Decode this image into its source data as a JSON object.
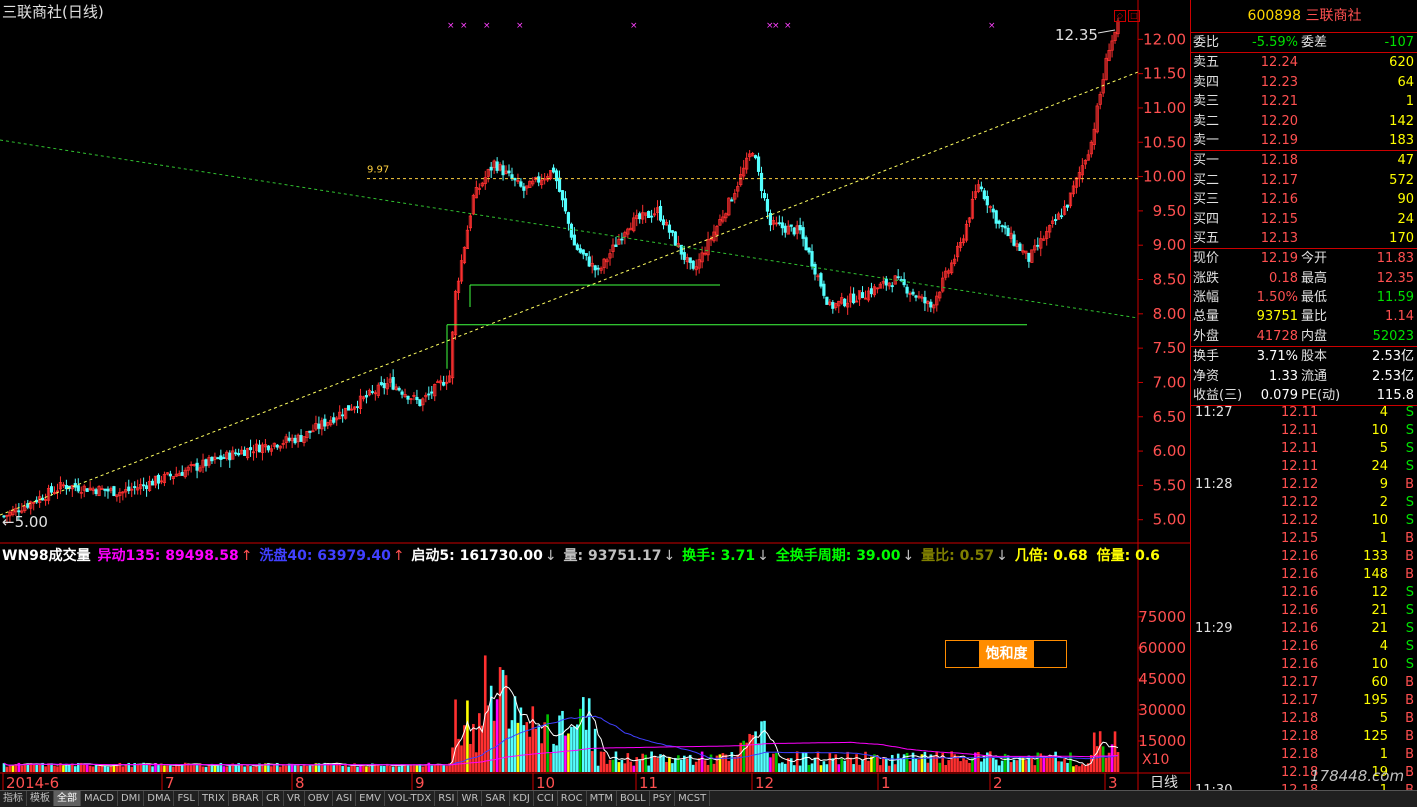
{
  "window": {
    "title": "三联商社(日线)"
  },
  "chart_data": {
    "type": "candlestick",
    "price_ticks": [
      "12.00",
      "11.50",
      "11.00",
      "10.50",
      "10.00",
      "9.50",
      "9.00",
      "8.50",
      "8.00",
      "7.50",
      "7.00",
      "6.50",
      "6.00",
      "5.50",
      "5.00"
    ],
    "volume_ticks": [
      "75000",
      "60000",
      "45000",
      "30000",
      "15000"
    ],
    "x_labels": [
      "2014-6",
      "7",
      "8",
      "9",
      "10",
      "11",
      "12",
      "1",
      "2",
      "3"
    ],
    "ylim": [
      4.85,
      12.5
    ],
    "annotations": {
      "high_label": "12.35",
      "low_label": "5.00",
      "level_label": "9.97"
    },
    "vol_ylim": [
      0,
      88000
    ]
  },
  "vol_header": {
    "name": "WN98成交量",
    "items": [
      {
        "label": "异动135: 89498.58",
        "arrow": "↑",
        "color": "#ff00ff"
      },
      {
        "label": "洗盘40: 63979.40",
        "arrow": "↑",
        "color": "#4040ff"
      },
      {
        "label": "启动5: 161730.00",
        "arrow": "↓",
        "color": "#ffffff"
      },
      {
        "label": "量: 93751.17",
        "arrow": "↓",
        "color": "#c0c0c0"
      },
      {
        "label": "换手: 3.71",
        "arrow": "↓",
        "color": "#00ff00"
      },
      {
        "label": "全换手周期: 39.00",
        "arrow": "↓",
        "color": "#00ff00"
      },
      {
        "label": "量比: 0.57",
        "arrow": "↓",
        "color": "#808000"
      },
      {
        "label": "几倍: 0.68",
        "arrow": "",
        "color": "#ffff00"
      },
      {
        "label": "倍量: 0.6",
        "arrow": "",
        "color": "#ffff00"
      }
    ]
  },
  "saturation_label": "饱和度",
  "x10_label": "X10",
  "period_label": "日线",
  "stock": {
    "code": "600898",
    "name": "三联商社"
  },
  "order_book": {
    "ratio": {
      "label": "委比",
      "value": "-5.59%",
      "label2": "委差",
      "value2": "-107"
    },
    "sell": [
      {
        "label": "卖五",
        "price": "12.24",
        "vol": "620"
      },
      {
        "label": "卖四",
        "price": "12.23",
        "vol": "64"
      },
      {
        "label": "卖三",
        "price": "12.21",
        "vol": "1"
      },
      {
        "label": "卖二",
        "price": "12.20",
        "vol": "142"
      },
      {
        "label": "卖一",
        "price": "12.19",
        "vol": "183"
      }
    ],
    "buy": [
      {
        "label": "买一",
        "price": "12.18",
        "vol": "47"
      },
      {
        "label": "买二",
        "price": "12.17",
        "vol": "572"
      },
      {
        "label": "买三",
        "price": "12.16",
        "vol": "90"
      },
      {
        "label": "买四",
        "price": "12.15",
        "vol": "24"
      },
      {
        "label": "买五",
        "price": "12.13",
        "vol": "170"
      }
    ]
  },
  "quote": [
    {
      "l1": "现价",
      "v1": "12.19",
      "c1": "red",
      "l2": "今开",
      "v2": "11.83",
      "c2": "red"
    },
    {
      "l1": "涨跌",
      "v1": "0.18",
      "c1": "red",
      "l2": "最高",
      "v2": "12.35",
      "c2": "red"
    },
    {
      "l1": "涨幅",
      "v1": "1.50%",
      "c1": "red",
      "l2": "最低",
      "v2": "11.59",
      "c2": "green"
    },
    {
      "l1": "总量",
      "v1": "93751",
      "c1": "yellow",
      "l2": "量比",
      "v2": "1.14",
      "c2": "red"
    },
    {
      "l1": "外盘",
      "v1": "41728",
      "c1": "red",
      "l2": "内盘",
      "v2": "52023",
      "c2": "green"
    }
  ],
  "fundamentals": [
    {
      "l1": "换手",
      "v1": "3.71%",
      "l2": "股本",
      "v2": "2.53亿"
    },
    {
      "l1": "净资",
      "v1": "1.33",
      "l2": "流通",
      "v2": "2.53亿"
    },
    {
      "l1": "收益(三)",
      "v1": "0.079",
      "l2": "PE(动)",
      "v2": "115.8"
    }
  ],
  "ticks": [
    {
      "time": "11:27",
      "price": "12.11",
      "vol": "4",
      "side": "S"
    },
    {
      "time": "",
      "price": "12.11",
      "vol": "10",
      "side": "S"
    },
    {
      "time": "",
      "price": "12.11",
      "vol": "5",
      "side": "S"
    },
    {
      "time": "",
      "price": "12.11",
      "vol": "24",
      "side": "S"
    },
    {
      "time": "11:28",
      "price": "12.12",
      "vol": "9",
      "side": "B"
    },
    {
      "time": "",
      "price": "12.12",
      "vol": "2",
      "side": "S"
    },
    {
      "time": "",
      "price": "12.12",
      "vol": "10",
      "side": "S"
    },
    {
      "time": "",
      "price": "12.15",
      "vol": "1",
      "side": "B"
    },
    {
      "time": "",
      "price": "12.16",
      "vol": "133",
      "side": "B"
    },
    {
      "time": "",
      "price": "12.16",
      "vol": "148",
      "side": "B"
    },
    {
      "time": "",
      "price": "12.16",
      "vol": "12",
      "side": "S"
    },
    {
      "time": "",
      "price": "12.16",
      "vol": "21",
      "side": "S"
    },
    {
      "time": "11:29",
      "price": "12.16",
      "vol": "21",
      "side": "S"
    },
    {
      "time": "",
      "price": "12.16",
      "vol": "4",
      "side": "S"
    },
    {
      "time": "",
      "price": "12.16",
      "vol": "10",
      "side": "S"
    },
    {
      "time": "",
      "price": "12.17",
      "vol": "60",
      "side": "B"
    },
    {
      "time": "",
      "price": "12.17",
      "vol": "195",
      "side": "B"
    },
    {
      "time": "",
      "price": "12.18",
      "vol": "5",
      "side": "B"
    },
    {
      "time": "",
      "price": "12.18",
      "vol": "125",
      "side": "B"
    },
    {
      "time": "",
      "price": "12.18",
      "vol": "1",
      "side": "B"
    },
    {
      "time": "",
      "price": "12.18",
      "vol": "19",
      "side": "B"
    },
    {
      "time": "11:30",
      "price": "12.18",
      "vol": "1",
      "side": "B"
    }
  ],
  "bottom_tabs": [
    "指标",
    "模板",
    "全部",
    "MACD",
    "DMI",
    "DMA",
    "FSL",
    "TRIX",
    "BRAR",
    "CR",
    "VR",
    "OBV",
    "ASI",
    "EMV",
    "VOL-TDX",
    "RSI",
    "WR",
    "SAR",
    "KDJ",
    "CCI",
    "ROC",
    "MTM",
    "BOLL",
    "PSY",
    "MCST"
  ],
  "watermark": "178448.com"
}
